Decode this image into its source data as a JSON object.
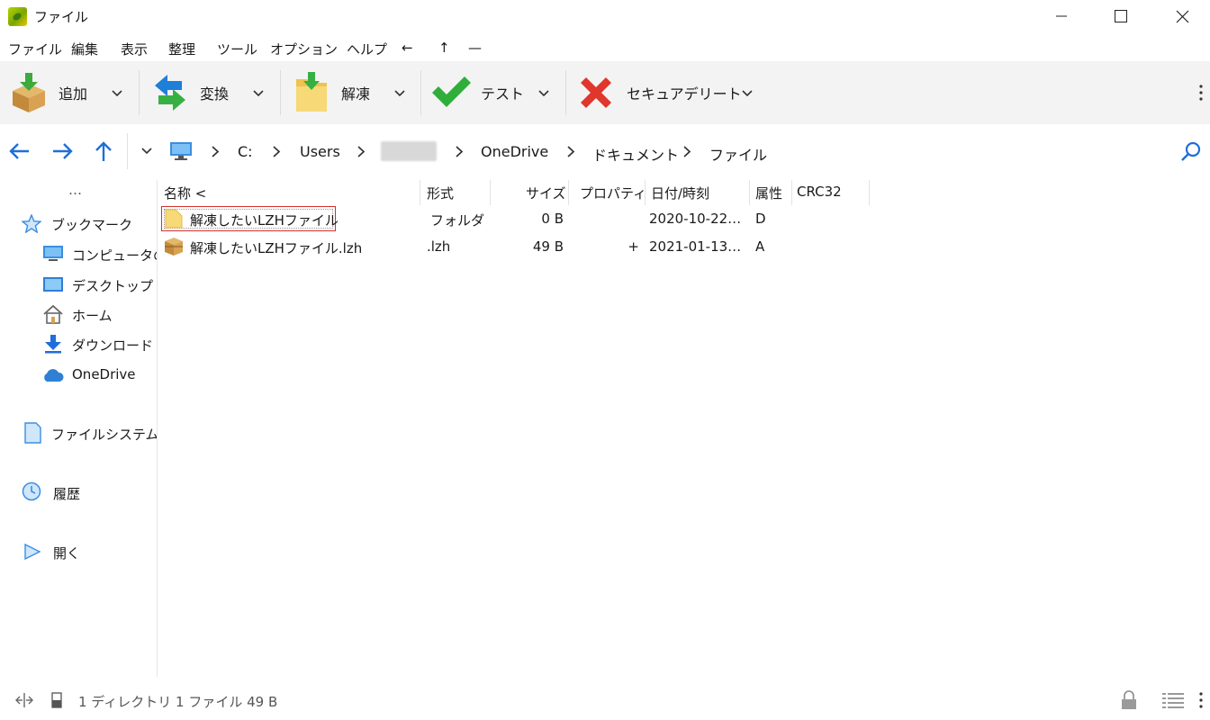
{
  "window": {
    "title": "ファイル"
  },
  "menu": [
    "ファイル",
    "編集",
    "表示",
    "整理",
    "ツール",
    "オプション",
    "ヘルプ",
    "←",
    "↑",
    "—"
  ],
  "toolbar": {
    "add_label": "追加",
    "convert_label": "変換",
    "extract_label": "解凍",
    "test_label": "テスト",
    "secure_delete_label": "セキュアデリート"
  },
  "breadcrumb": {
    "drive": "C:",
    "users": "Users",
    "onedrive": "OneDrive",
    "documents": "ドキュメント",
    "current": "ファイル"
  },
  "sidebar": {
    "more": "…",
    "bookmarks": "ブックマーク",
    "computer": "コンピュータの",
    "desktop": "デスクトップ",
    "home": "ホーム",
    "downloads": "ダウンロード",
    "onedrive": "OneDrive",
    "filesystem": "ファイルシステム",
    "history": "履歴",
    "open": "開く"
  },
  "columns": {
    "name": "名称 <",
    "type": "形式",
    "size": "サイズ",
    "properties": "プロパティ",
    "date": "日付/時刻",
    "attr": "属性",
    "crc": "CRC32"
  },
  "files": [
    {
      "name": "解凍したいLZHファイル",
      "type": "フォルダ",
      "size": "0 B",
      "prop": "",
      "date": "2020-10-22…",
      "attr": "D",
      "icon": "folder-icon"
    },
    {
      "name": "解凍したいLZHファイル.lzh",
      "type": ".lzh",
      "size": "49 B",
      "prop": "+",
      "date": "2021-01-13…",
      "attr": "A",
      "icon": "archive-icon"
    }
  ],
  "status": {
    "summary": "1 ディレクトリ 1 ファイル 49 B"
  },
  "colors": {
    "accent": "#1e6fd9",
    "selection_border": "#d32f2f",
    "toolbar_bg": "#f3f3f3"
  }
}
